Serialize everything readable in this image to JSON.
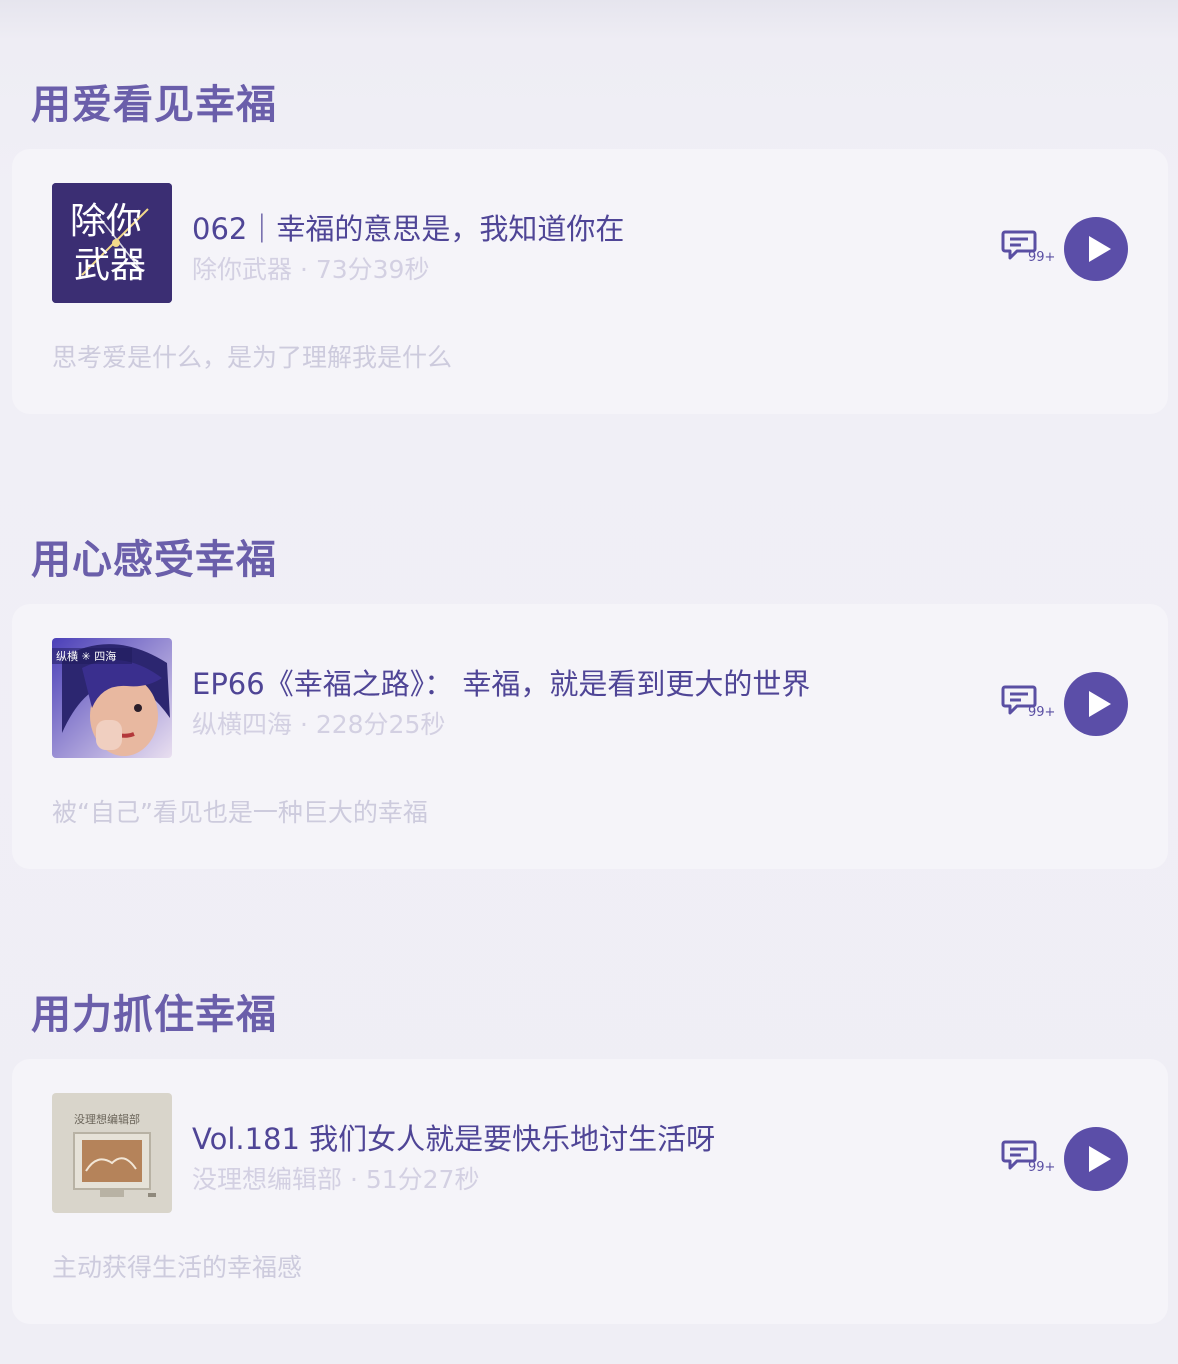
{
  "sections": [
    {
      "title": "用爱看见幸福",
      "episode": {
        "cover": {
          "text_line1": "除你",
          "text_line2": "武器",
          "bg": "#3b2e73"
        },
        "title": "062｜幸福的意思是，我知道你在",
        "meta": "除你武器 · 73分39秒",
        "description": "思考爱是什么，是为了理解我是什么",
        "comment_count": "99+"
      }
    },
    {
      "title": "用心感受幸福",
      "episode": {
        "cover": {
          "label": "纵横 ✳ 四海"
        },
        "title": "EP66《幸福之路》：  幸福，就是看到更大的世界",
        "meta": "纵横四海 · 228分25秒",
        "description": "被“自己”看见也是一种巨大的幸福",
        "comment_count": "99+"
      }
    },
    {
      "title": "用力抓住幸福",
      "episode": {
        "cover": {
          "label": "没理想编辑部"
        },
        "title": "Vol.181 我们女人就是要快乐地讨生活呀",
        "meta": "没理想编辑部 · 51分27秒",
        "description": "主动获得生活的幸福感",
        "comment_count": "99+"
      }
    }
  ],
  "colors": {
    "accent": "#5b4ea8",
    "title": "#6a5eaa",
    "episode_title": "#4f4596",
    "muted": "#d3d0e2"
  },
  "icons": {
    "comment": "comment-icon",
    "play": "play-icon"
  }
}
